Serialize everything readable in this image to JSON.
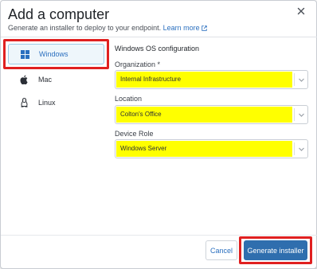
{
  "dialog": {
    "title": "Add a computer",
    "subtitle": "Generate an installer to deploy to your endpoint.",
    "learn_more": "Learn more",
    "close_icon": "close-icon",
    "external_link_icon": "external-link-icon"
  },
  "sidebar": {
    "items": [
      {
        "label": "Windows",
        "icon": "windows-icon",
        "selected": true
      },
      {
        "label": "Mac",
        "icon": "apple-icon",
        "selected": false
      },
      {
        "label": "Linux",
        "icon": "linux-icon",
        "selected": false
      }
    ]
  },
  "form": {
    "section_title": "Windows OS configuration",
    "organization": {
      "label": "Organization *",
      "value": "Internal Infrastructure"
    },
    "location": {
      "label": "Location",
      "value": "Colton's Office"
    },
    "device_role": {
      "label": "Device Role",
      "value": "Windows Server"
    }
  },
  "footer": {
    "cancel_label": "Cancel",
    "generate_label": "Generate installer"
  },
  "colors": {
    "accent": "#2f6eae",
    "link": "#2a6fbf",
    "highlight_yellow": "#ffff00",
    "highlight_red": "#e02020",
    "selected_bg": "#eef6fb"
  }
}
